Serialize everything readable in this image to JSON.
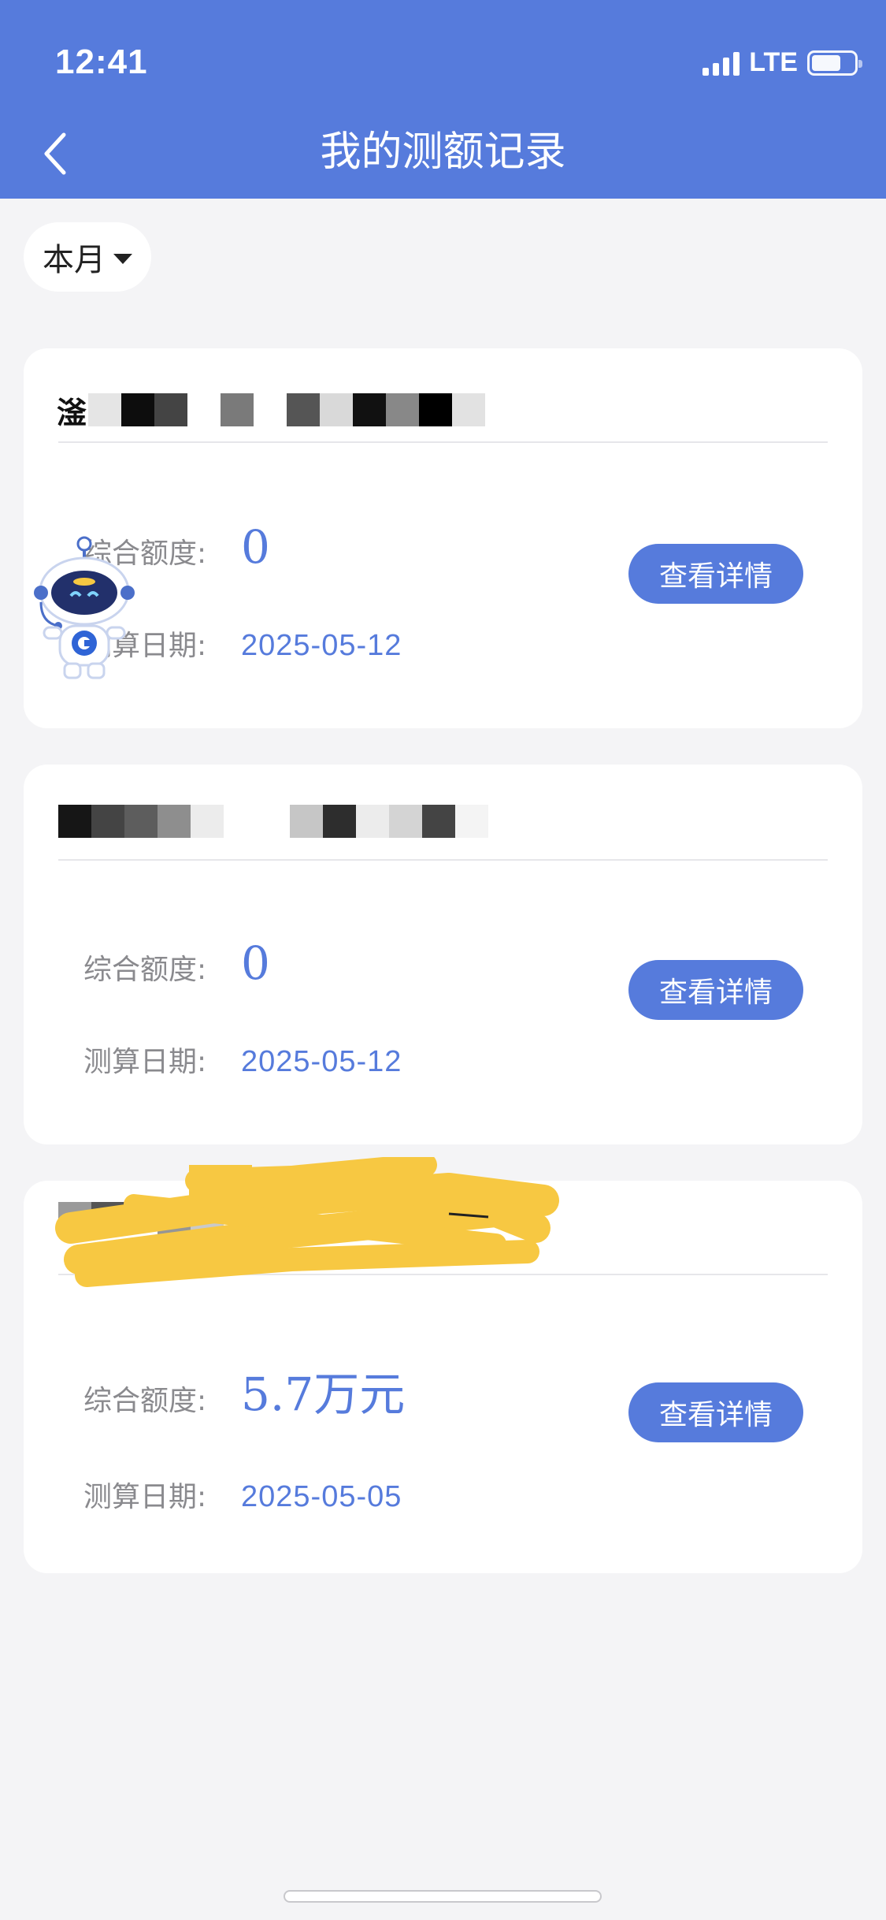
{
  "status_bar": {
    "time": "12:41",
    "network": "LTE"
  },
  "header": {
    "title": "我的测额记录",
    "back_icon": "chevron-left-icon"
  },
  "filter": {
    "selected": "本月",
    "icon": "caret-down-icon"
  },
  "records": [
    {
      "name_prefix": "滏",
      "amount_label": "综合额度:",
      "amount": "0",
      "date_label": "测算日期:",
      "date": "2025-05-12",
      "button_label": "查看详情"
    },
    {
      "name_prefix": "",
      "amount_label": "综合额度:",
      "amount": "0",
      "date_label": "测算日期:",
      "date": "2025-05-12",
      "button_label": "查看详情"
    },
    {
      "name_prefix": "",
      "amount_label": "综合额度:",
      "amount": "5.7万元",
      "date_label": "测算日期:",
      "date": "2025-05-05",
      "button_label": "查看详情"
    }
  ],
  "colors": {
    "primary": "#567bdc",
    "background": "#f4f4f6",
    "label_gray": "#8a8a8e",
    "scribble": "#f7c842"
  }
}
